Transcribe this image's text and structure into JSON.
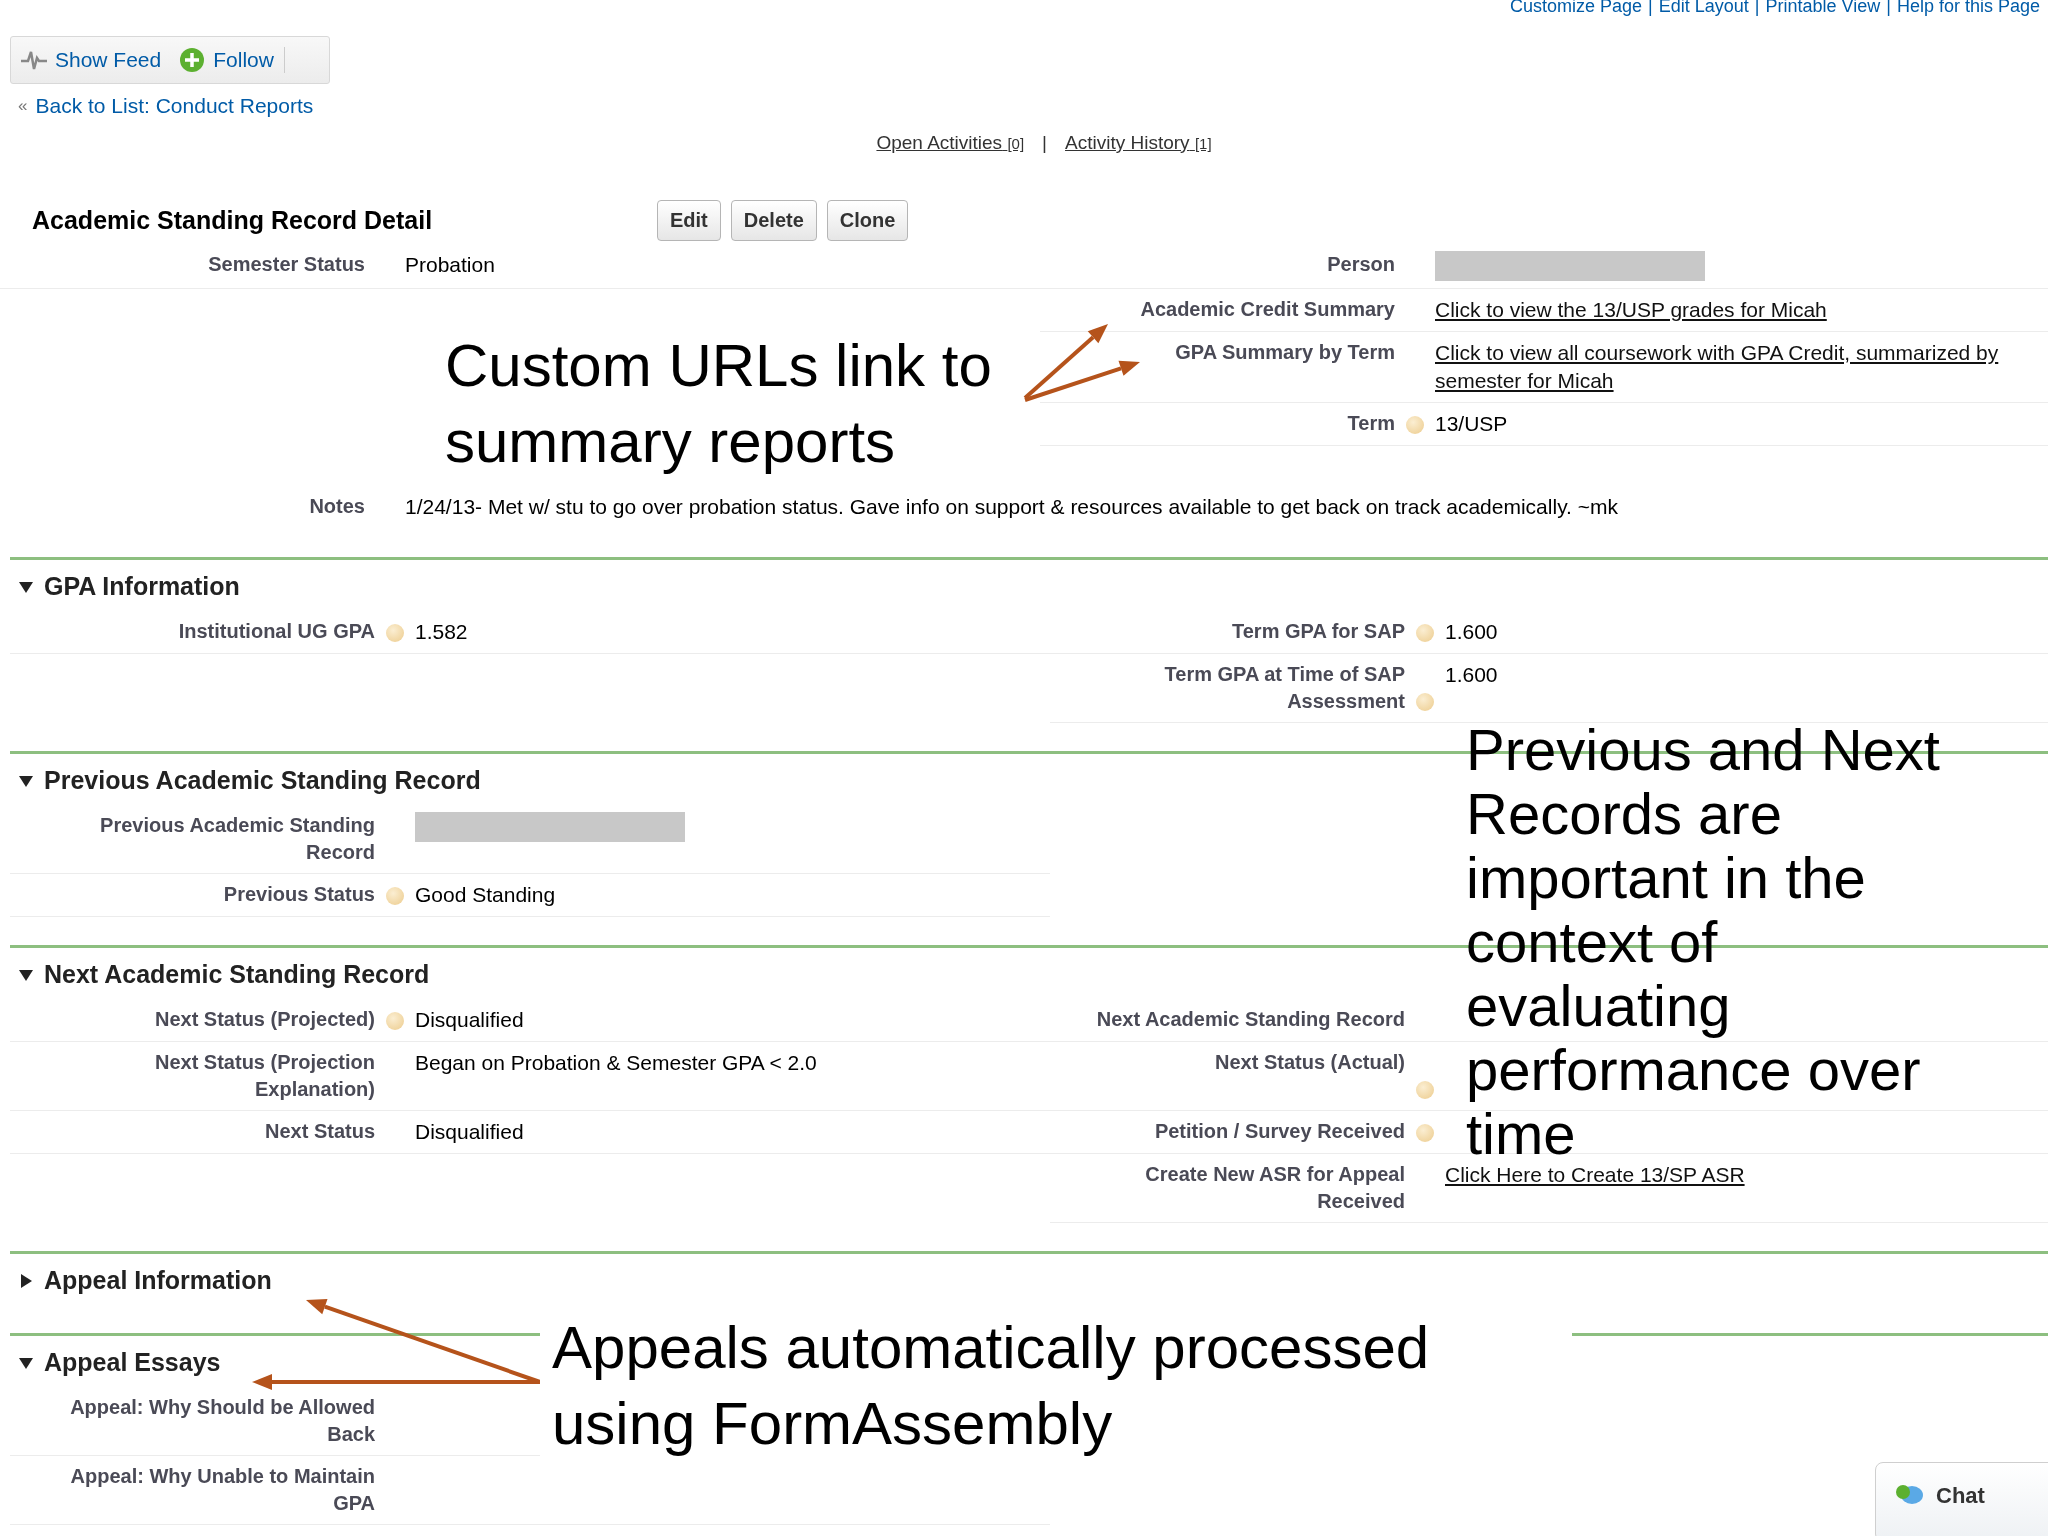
{
  "top_links": {
    "items": [
      "Customize Page",
      "Edit Layout",
      "Printable View",
      "Help for this Page"
    ],
    "separator": "|"
  },
  "toolbar": {
    "items": [
      {
        "kind": "feed",
        "label": "Show Feed"
      },
      {
        "kind": "follow",
        "label": "Follow"
      }
    ]
  },
  "back": {
    "marker": "«",
    "label": "Back to List: Conduct Reports"
  },
  "related": {
    "items": [
      {
        "label": "Open Activities",
        "count": "[0]"
      },
      {
        "label": "Activity History",
        "count": "[1]"
      }
    ],
    "separator": "|"
  },
  "detail": {
    "title": "Academic Standing Record Detail",
    "buttons": [
      "Edit",
      "Delete",
      "Clone"
    ]
  },
  "sections": [
    {
      "rows": [
        {
          "left": {
            "label": "Semester Status",
            "value": "Probation",
            "kind": "text",
            "help": false
          },
          "right": {
            "label": "Person",
            "kind": "redacted",
            "help": false
          }
        },
        {
          "left": null,
          "right": {
            "label": "Academic Credit Summary",
            "value": "Click to view the 13/USP grades for Micah",
            "kind": "link",
            "help": false
          }
        },
        {
          "left": null,
          "right": {
            "label": "GPA Summary by Term",
            "value": "Click to view all coursework with GPA Credit, summarized by semester for Micah",
            "kind": "link",
            "help": false
          }
        },
        {
          "left": null,
          "right": {
            "label": "Term",
            "value": "13/USP",
            "kind": "text",
            "help": true
          }
        },
        {
          "full": {
            "label": "Notes",
            "value": "1/24/13- Met w/ stu to go over probation status. Gave info on support & resources available to get back on track academically. ~mk",
            "kind": "text",
            "help": false
          }
        }
      ]
    },
    {
      "title": "GPA Information",
      "expanded": true,
      "rows": [
        {
          "left": {
            "label": "Institutional UG GPA",
            "value": "1.582",
            "kind": "text",
            "help": true
          },
          "right": {
            "label": "Term GPA for SAP",
            "value": "1.600",
            "kind": "text",
            "help": true
          }
        },
        {
          "left": null,
          "right": {
            "label": "Term GPA at Time of SAP Assessment",
            "value": "1.600",
            "kind": "text",
            "help": true
          }
        }
      ]
    },
    {
      "title": "Previous Academic Standing Record",
      "expanded": true,
      "rows": [
        {
          "left": {
            "label": "Previous Academic Standing Record",
            "kind": "redacted",
            "help": false
          },
          "right": null
        },
        {
          "left": {
            "label": "Previous Status",
            "value": "Good Standing",
            "kind": "text",
            "help": true
          },
          "right": null
        }
      ]
    },
    {
      "title": "Next Academic Standing Record",
      "expanded": true,
      "rows": [
        {
          "left": {
            "label": "Next Status (Projected)",
            "value": "Disqualified",
            "kind": "text",
            "help": true
          },
          "right": {
            "label": "Next Academic Standing Record",
            "kind": "text",
            "help": false
          }
        },
        {
          "left": {
            "label": "Next Status (Projection Explanation)",
            "value": "Began on Probation & Semester GPA < 2.0",
            "kind": "text",
            "help": false
          },
          "right": {
            "label": "Next Status (Actual)",
            "kind": "text",
            "help": true
          }
        },
        {
          "left": {
            "label": "Next Status",
            "value": "Disqualified",
            "kind": "text",
            "help": false
          },
          "right": {
            "label": "Petition / Survey Received",
            "kind": "text",
            "help": true
          }
        },
        {
          "left": null,
          "right": {
            "label": "Create New ASR for Appeal Received",
            "value": "Click Here to Create 13/SP ASR",
            "kind": "link",
            "help": false
          }
        }
      ]
    },
    {
      "title": "Appeal Information",
      "expanded": false
    },
    {
      "title": "Appeal Essays",
      "expanded": true,
      "rows": [
        {
          "left": {
            "label": "Appeal: Why Should be Allowed Back",
            "kind": "text",
            "help": false
          },
          "right": null
        },
        {
          "left": {
            "label": "Appeal: Why Unable to Maintain GPA",
            "kind": "text",
            "help": false
          },
          "right": null
        }
      ]
    }
  ],
  "annotations": [
    {
      "kind": "urls",
      "text": "Custom URLs link to summary reports"
    },
    {
      "kind": "records",
      "text": "Previous and Next Records are important in the context of evaluating performance over time"
    },
    {
      "kind": "appeals",
      "text": "Appeals automatically processed using FormAssembly"
    }
  ],
  "chat": {
    "label": "Chat"
  }
}
